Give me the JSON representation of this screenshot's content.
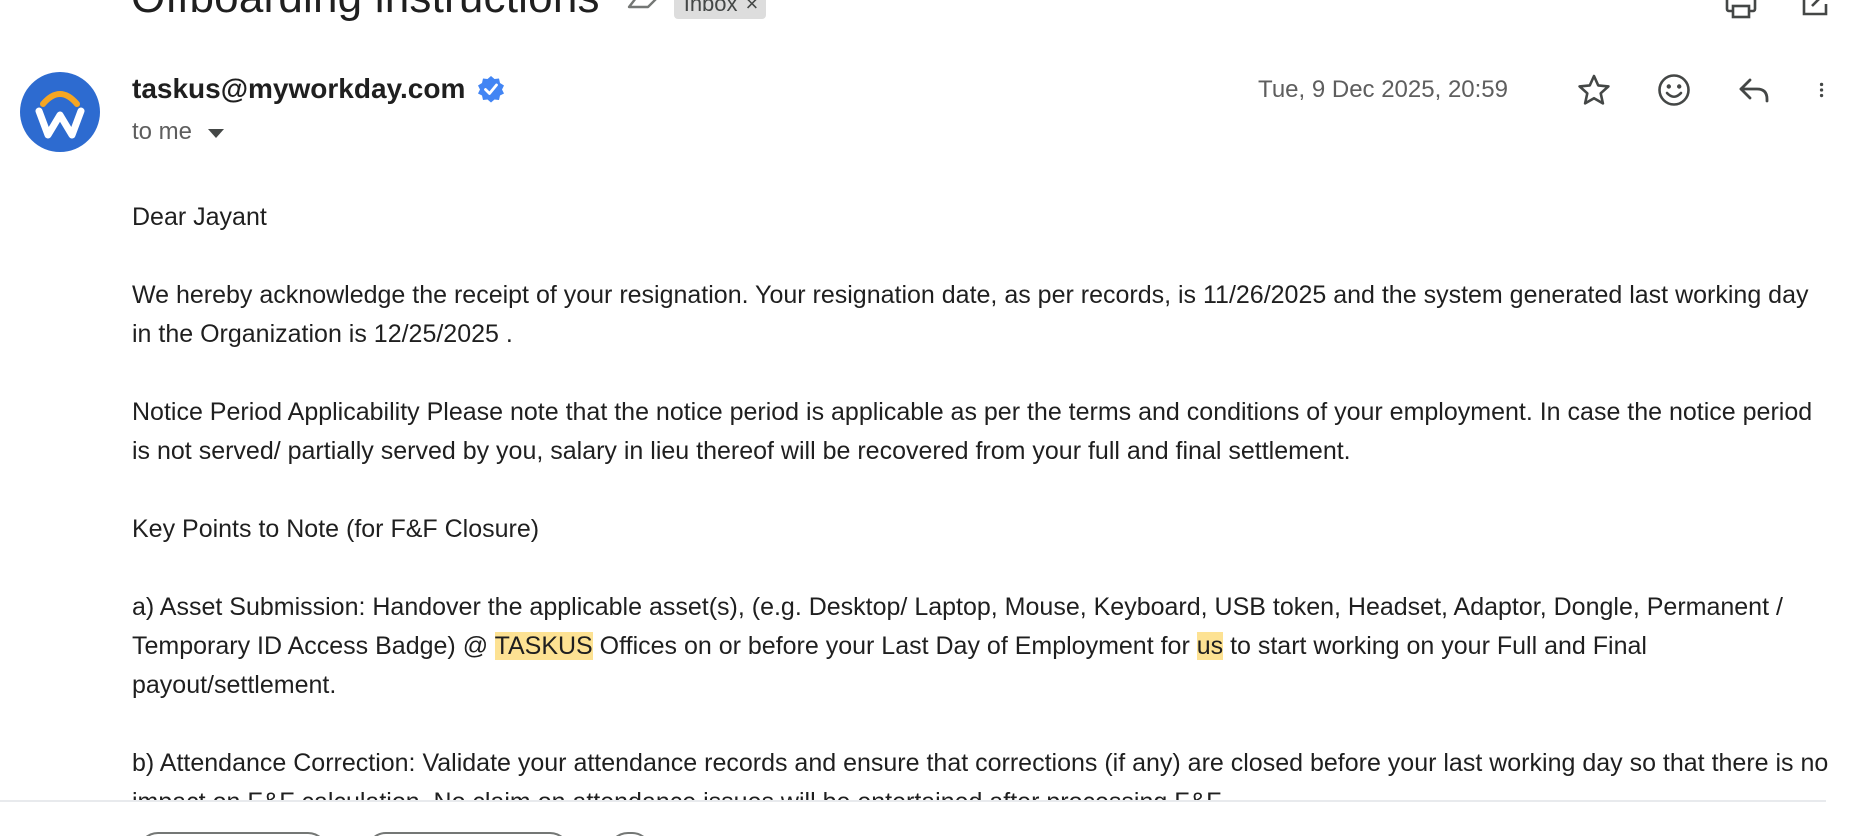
{
  "email": {
    "subject": "Offboarding instructions",
    "label_chip": "Inbox",
    "label_chip_close": "×",
    "sender": "taskus@myworkday.com",
    "recipient": "to me",
    "date": "Tue, 9 Dec 2025, 20:59",
    "body": {
      "greeting": "Dear Jayant",
      "para1": "We hereby acknowledge the receipt of your resignation. Your resignation date, as per records, is 11/26/2025 and the system generated last working day in the Organization is 12/25/2025 .",
      "para2": "Notice Period Applicability Please note that the notice period is applicable as per the terms and conditions of your employment. In case the notice period is not served/ partially served by you, salary in lieu thereof will be recovered from your full and final settlement.",
      "para3": "Key Points to Note (for F&F Closure)",
      "para4_a": "a) Asset Submission: Handover the applicable asset(s), (e.g. Desktop/ Laptop, Mouse, Keyboard, USB token, Headset, Adaptor, Dongle, Permanent / Temporary ID Access Badge) @ ",
      "para4_hl1": "TASKUS",
      "para4_b": " Offices on or before your Last Day of Employment for ",
      "para4_hl2": "us",
      "para4_c": " to start working on your Full and Final payout/settlement.",
      "para5": "b) Attendance Correction: Validate your attendance records and ensure that corrections (if any) are closed before your last working day so that there is no impact on F&F calculation. No claim on attendance issues will be entertained after processing F&F."
    }
  },
  "icons": {
    "label": "label-arrow-icon",
    "print": "print-icon",
    "open_new_window": "open-in-new-window-icon",
    "verified": "verified-badge-icon",
    "star": "star-icon",
    "emoji": "emoji-reaction-icon",
    "reply": "reply-icon",
    "more": "more-vertical-icon"
  },
  "colors": {
    "avatar_bg": "#2d6bd0",
    "avatar_arc": "#f5a623",
    "verified": "#4285f4",
    "highlight": "#fde293",
    "chip_bg": "#dddddd"
  }
}
